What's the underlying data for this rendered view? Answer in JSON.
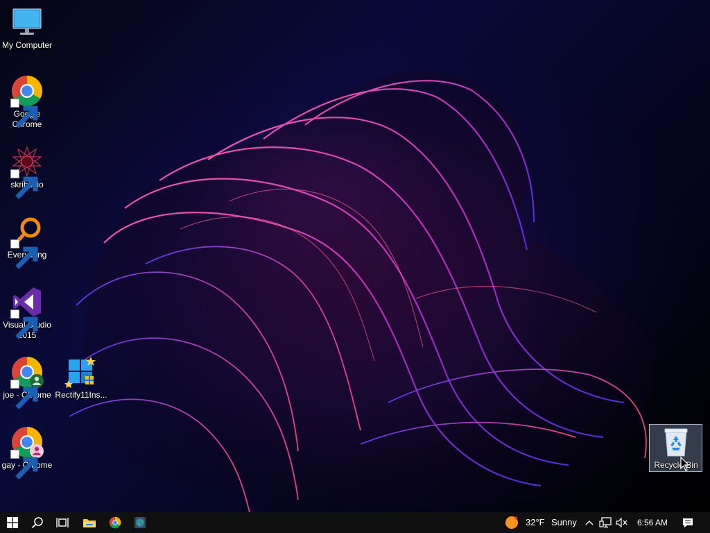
{
  "desktop": {
    "icons": [
      {
        "label": "My Computer",
        "icon": "monitor-icon"
      },
      {
        "label": "Google Chrome",
        "icon": "chrome-icon",
        "shortcut": true
      },
      {
        "label": "skribbl.io",
        "icon": "skribbl-icon",
        "shortcut": true
      },
      {
        "label": "Everything",
        "icon": "everything-search-icon",
        "shortcut": true
      },
      {
        "label": "Visual Studio 2015",
        "icon": "visual-studio-icon",
        "shortcut": true
      },
      {
        "label": "joe - Chrome",
        "icon": "chrome-profile-icon",
        "shortcut": true
      },
      {
        "label": "Rectify11Ins...",
        "icon": "rectify11-installer-icon"
      },
      {
        "label": "gay - Chrome",
        "icon": "chrome-profile-icon",
        "shortcut": true
      },
      {
        "label": "Recycle Bin",
        "icon": "recycle-bin-icon",
        "selected": true
      }
    ]
  },
  "taskbar": {
    "pinned": [
      "start-icon",
      "search-icon",
      "task-view-icon",
      "file-explorer-icon",
      "chrome-icon",
      "globe-app-icon"
    ],
    "weather": {
      "temperature": "32°F",
      "condition": "Sunny",
      "icon": "sun-icon"
    },
    "tray_icons": [
      "chevron-up-icon",
      "network-icon",
      "volume-muted-icon"
    ],
    "clock": "6:56 AM",
    "notification_icon": "action-center-icon"
  },
  "colors": {
    "taskbar": "#101010",
    "wallpaper_accent": "#c03aa8",
    "selection": "#8aa0c4"
  }
}
